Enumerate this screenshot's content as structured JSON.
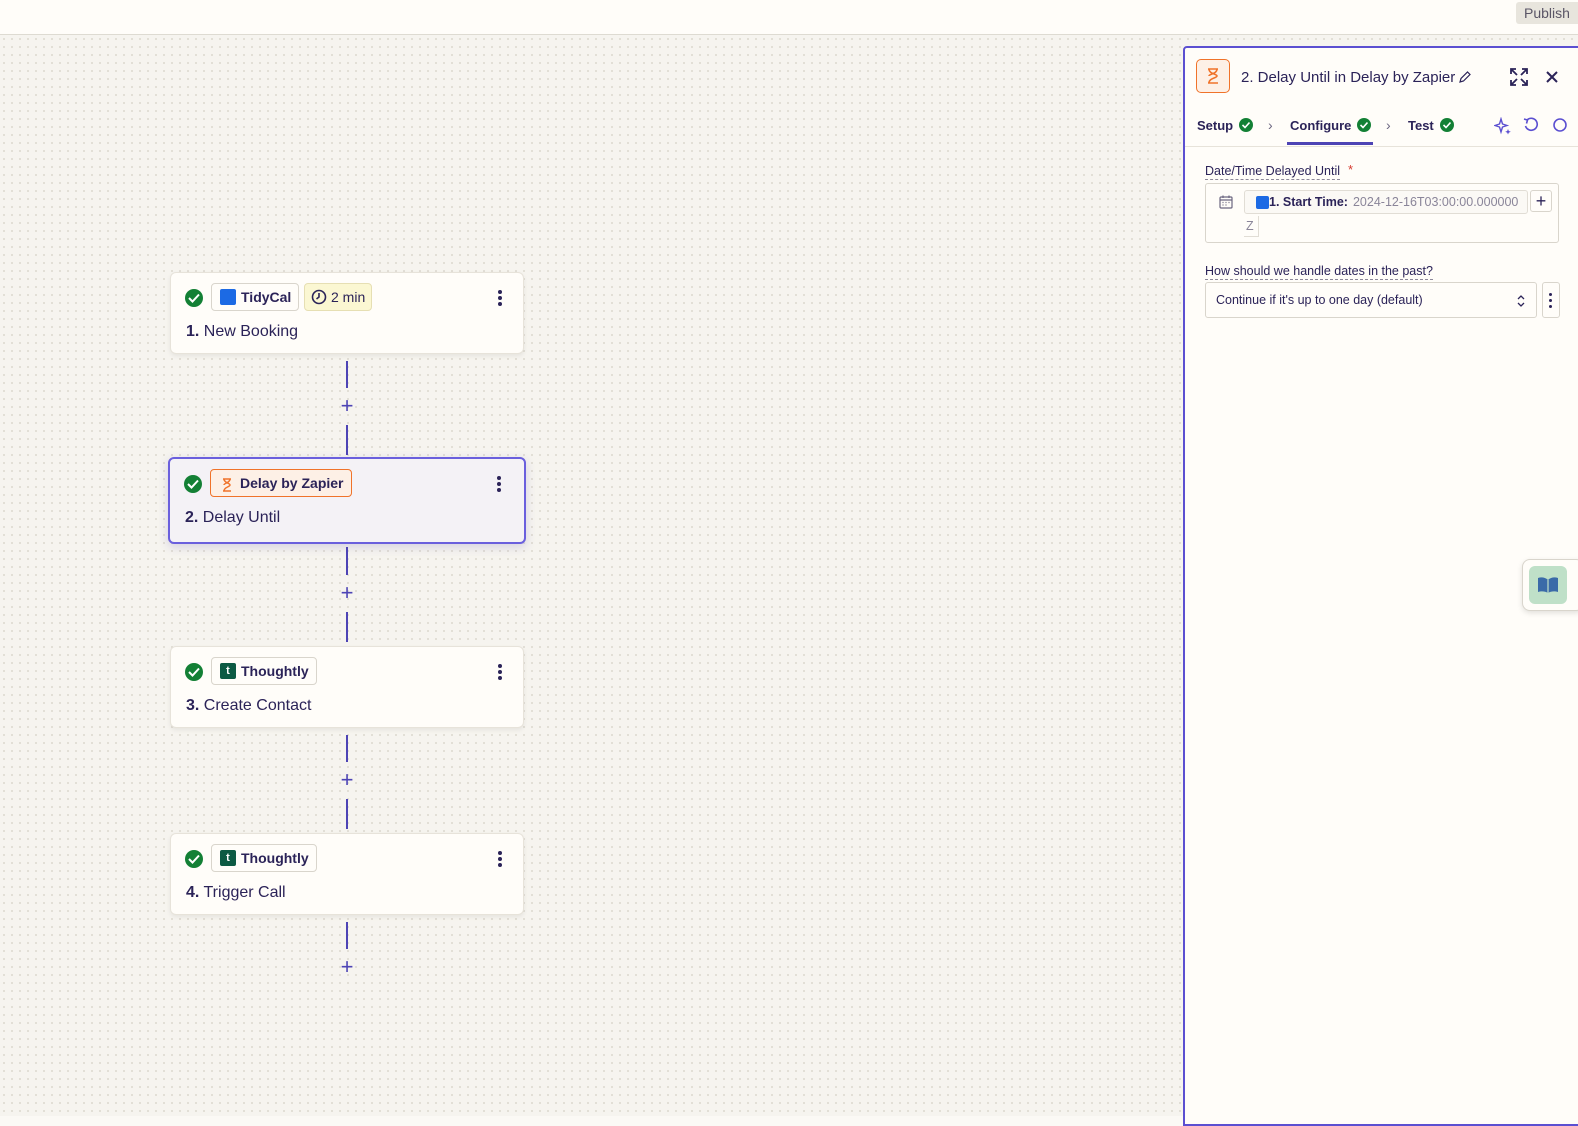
{
  "topbar": {
    "publish_label": "Publish"
  },
  "steps": [
    {
      "app": "TidyCal",
      "number": "1.",
      "title": "New Booking",
      "time": "2 min"
    },
    {
      "app": "Delay by Zapier",
      "number": "2.",
      "title": "Delay Until"
    },
    {
      "app": "Thoughtly",
      "number": "3.",
      "title": "Create Contact"
    },
    {
      "app": "Thoughtly",
      "number": "4.",
      "title": "Trigger Call"
    }
  ],
  "panel": {
    "title": "2. Delay Until in Delay by Zapier",
    "tabs": [
      {
        "label": "Setup"
      },
      {
        "label": "Configure"
      },
      {
        "label": "Test"
      }
    ],
    "fields": {
      "datetime": {
        "label": "Date/Time Delayed Until",
        "required_mark": "*",
        "pill_label": "1. Start Time:",
        "pill_value": "2024-12-16T03:00:00.000000",
        "pill_overflow": "Z"
      },
      "past_dates": {
        "label": "How should we handle dates in the past?",
        "selected": "Continue if it's up to one day (default)"
      }
    }
  },
  "colors": {
    "accent": "#4d44b5",
    "success": "#138035",
    "delay_orange": "#f0732a",
    "tidycal_blue": "#1c6ae4",
    "thoughtly_green": "#0c5a43"
  }
}
